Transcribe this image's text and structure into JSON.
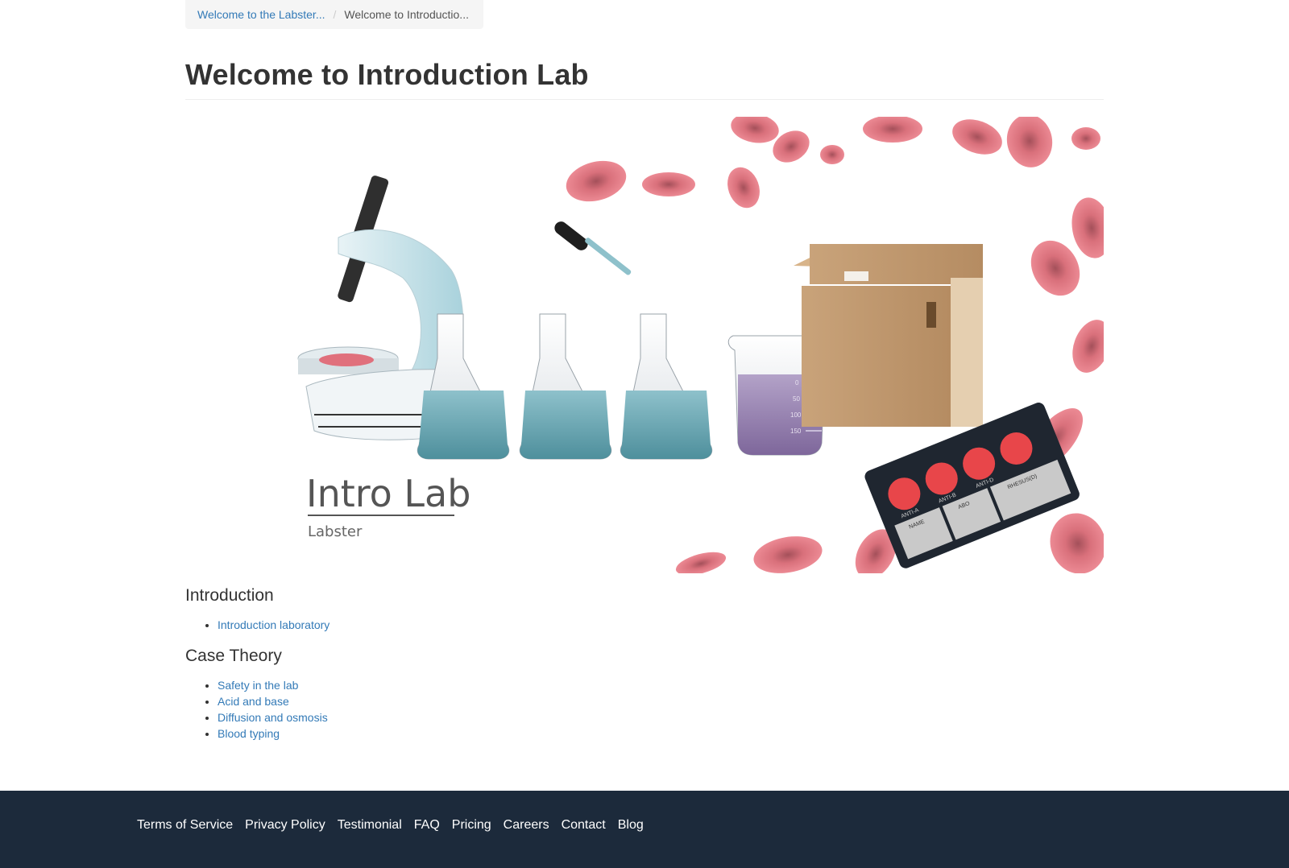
{
  "breadcrumb": {
    "items": [
      {
        "label": "Welcome to the Labster..."
      },
      {
        "label": "Welcome to Introductio..."
      }
    ],
    "separator": "/"
  },
  "page": {
    "title": "Welcome to Introduction Lab"
  },
  "banner": {
    "logo_title": "Intro Lab",
    "logo_subtitle": "Labster",
    "card_labels": [
      "ANTI-A",
      "ANTI-B",
      "ANTI-D",
      "NAME",
      "ABO",
      "RHESUS(D)"
    ],
    "beaker_marks": [
      "0",
      "50",
      "100",
      "150"
    ]
  },
  "sections": [
    {
      "title": "Introduction",
      "links": [
        "Introduction laboratory"
      ]
    },
    {
      "title": "Case Theory",
      "links": [
        "Safety in the lab",
        "Acid and base",
        "Diffusion and osmosis",
        "Blood typing"
      ]
    }
  ],
  "footer": {
    "links": [
      "Terms of Service",
      "Privacy Policy",
      "Testimonial",
      "FAQ",
      "Pricing",
      "Careers",
      "Contact",
      "Blog"
    ]
  },
  "colors": {
    "link": "#337ab7",
    "footer_bg": "#1c2a3b",
    "blood_cell": "#e87c86",
    "liquid_teal": "#6fa9b4",
    "liquid_purple": "#9b84b2"
  }
}
